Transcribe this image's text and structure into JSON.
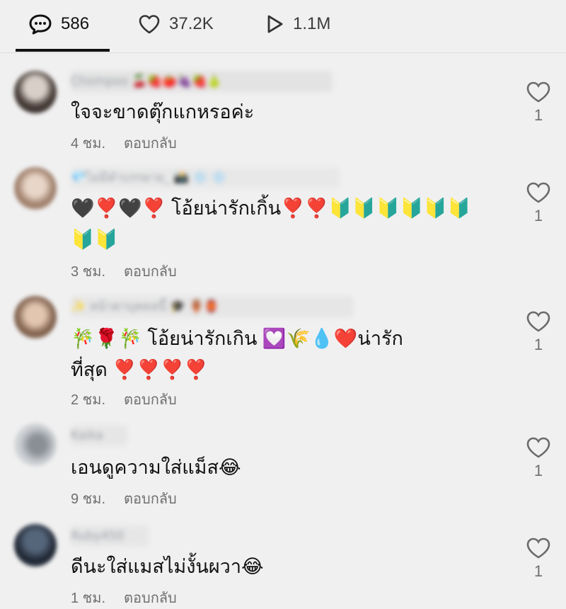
{
  "tabs": [
    {
      "icon": "comment-icon",
      "label": "586"
    },
    {
      "icon": "heart-icon",
      "label": "37.2K"
    },
    {
      "icon": "play-icon",
      "label": "1.1M"
    }
  ],
  "reply_label": "ตอบกลับ",
  "comments": [
    {
      "username": "Chompoo 🍒🍓🍅🍇🍓🍐",
      "text": "ใจจะขาดตุ๊กแกหรอค่ะ",
      "time": "4 ชม.",
      "likes": "1"
    },
    {
      "username": "💎ไม่มีคำบรรยาย_ 📸 ❄️ ❄️",
      "text_parts": [
        "🖤❣️🖤❣️ ",
        "โอ้ยน่ารักเกิ้น",
        "❣️❣️🔰🔰🔰🔰🔰🔰🔰🔰"
      ],
      "time": "3 ชม.",
      "likes": "1"
    },
    {
      "username": "✨ หน้าตาบุคคลนี้ 🎓 🏺🏮",
      "text_parts": [
        "🎋🌹🎋 ",
        "โอ้ยน่ารักเกิน ",
        "💟🌾💧❤️",
        "น่ารัก",
        "ที่สุด",
        "❣️❣️❣️❣️"
      ],
      "time": "2 ชม.",
      "likes": "1"
    },
    {
      "username": "Kaika",
      "text": "เอนดูความใส่แม็ส😂",
      "time": "9 ชม.",
      "likes": "1"
    },
    {
      "username": "Ruby450",
      "text": "ดีนะใส่แมสไม่งั้นผวา😂",
      "time": "1 ชม.",
      "likes": "1"
    }
  ],
  "colors": {
    "background": "#f0f0f0",
    "text": "#111111",
    "muted": "#6f6f6f"
  }
}
